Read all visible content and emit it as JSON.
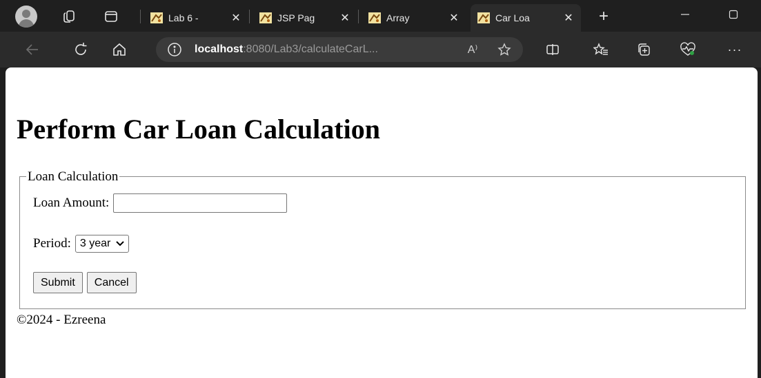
{
  "browser": {
    "tabs": [
      {
        "label": "Lab 6 -",
        "active": false
      },
      {
        "label": "JSP Pag",
        "active": false
      },
      {
        "label": "Array",
        "active": false
      },
      {
        "label": "Car Loa",
        "active": true
      }
    ],
    "new_tab_symbol": "+",
    "address": {
      "host": "localhost",
      "rest": ":8080/Lab3/calculateCarL..."
    },
    "read_aloud": "A⁾",
    "colors": {
      "frame": "#1f1f1f",
      "toolbar": "#2b2b2b",
      "omnibox": "#3b3b3b"
    }
  },
  "page": {
    "title": "Perform Car Loan Calculation",
    "form": {
      "legend": "Loan Calculation",
      "amount_label": "Loan Amount:",
      "amount_value": "",
      "period_label": "Period:",
      "period_selected": "3 year",
      "submit_label": "Submit",
      "cancel_label": "Cancel"
    },
    "footer": "©2024 - Ezreena"
  }
}
